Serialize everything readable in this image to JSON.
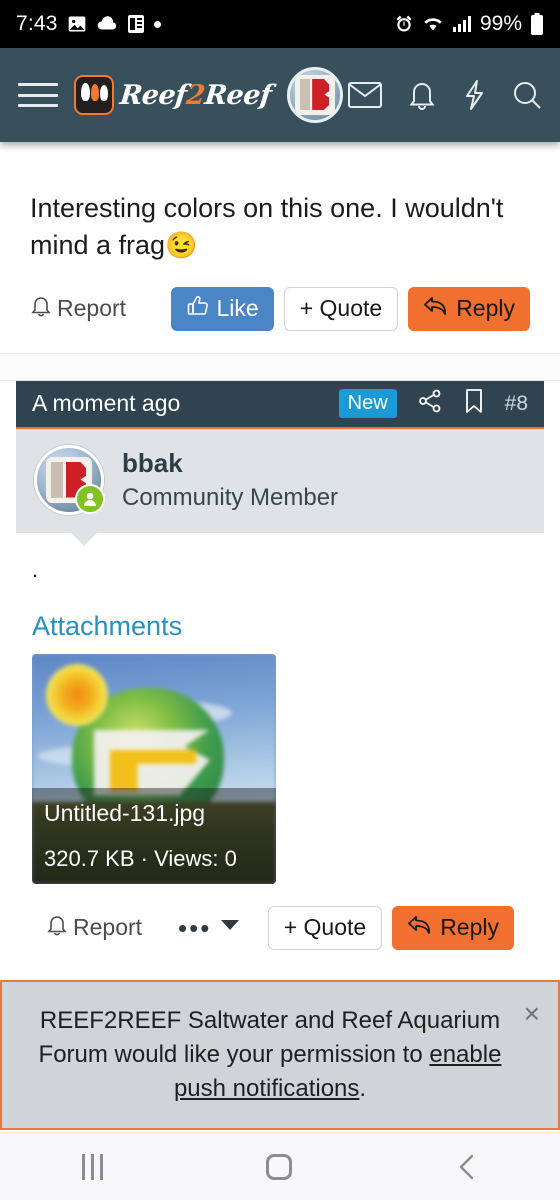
{
  "status_bar": {
    "time": "7:43",
    "left_icons": [
      "image-icon",
      "cloud-icon",
      "document-icon",
      "dot-icon"
    ],
    "right_icons": [
      "alarm-icon",
      "wifi-icon",
      "signal-icon"
    ],
    "battery": "99%"
  },
  "header": {
    "menu_icon": "hamburger-icon",
    "brand_name_part1": "Reef",
    "brand_name_two": "2",
    "brand_name_part2": "Reef",
    "icons": [
      "envelope-icon",
      "bell-icon",
      "bolt-icon",
      "search-icon"
    ],
    "background": "#37505c"
  },
  "previous_post": {
    "text": "Interesting colors on this one. I wouldn't mind a frag",
    "emoji": "😉",
    "actions": {
      "report": "Report",
      "like": "Like",
      "quote": "+ Quote",
      "reply": "Reply"
    }
  },
  "post": {
    "date": "A moment ago",
    "new_badge": "New",
    "post_number": "#8",
    "share_icon": "share-icon",
    "bookmark_icon": "bookmark-icon",
    "user": {
      "name": "bbak",
      "title": "Community Member",
      "online": true
    },
    "body": ".",
    "attachments_title": "Attachments",
    "attachment": {
      "filename": "Untitled-131.jpg",
      "meta": "320.7 KB · Views: 0"
    },
    "actions": {
      "report": "Report",
      "more": "•••",
      "quote": "+ Quote",
      "reply": "Reply"
    }
  },
  "push_banner": {
    "text_before": "REEF2REEF Saltwater and Reef Aquarium Forum would like your permission to ",
    "link_text": "enable push notifications",
    "text_after": ".",
    "close_label": "×",
    "border_color": "#e8793a"
  },
  "nav_bar": {
    "recents": "recents-icon",
    "home": "home-icon",
    "back": "back-icon"
  },
  "colors": {
    "header_bg": "#37505c",
    "post_head_bg": "#2f4450",
    "accent_orange": "#f1702f",
    "like_blue": "#4a86c5",
    "badge_blue": "#1b9ad6",
    "link_blue": "#2a8fc4",
    "online_green": "#82c225"
  }
}
